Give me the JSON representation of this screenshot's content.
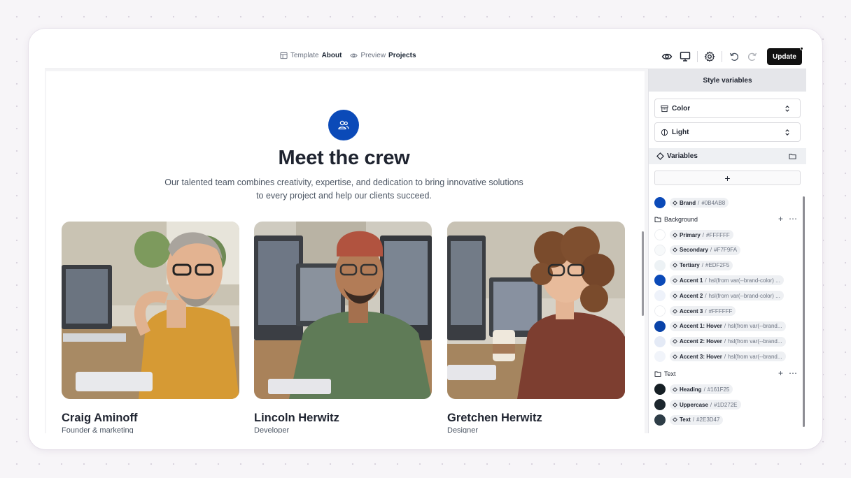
{
  "topbar": {
    "template_label": "Template",
    "template_value": "About",
    "preview_label": "Preview",
    "preview_value": "Projects",
    "update_label": "Update"
  },
  "page": {
    "title": "Meet the crew",
    "subtitle_line1": "Our talented team combines creativity, expertise, and dedication to bring innovative solutions",
    "subtitle_line2": "to every project and help our clients succeed.",
    "team": [
      {
        "name": "Craig Aminoff",
        "role": "Founder & marketing"
      },
      {
        "name": "Lincoln Herwitz",
        "role": "Developer"
      },
      {
        "name": "Gretchen Herwitz",
        "role": "Designer"
      }
    ]
  },
  "panel": {
    "title": "Style variables",
    "color_select": "Color",
    "mode_select": "Light",
    "variables_label": "Variables",
    "add_label": "+",
    "brand": {
      "name": "Brand",
      "value": "#0B4AB8",
      "color": "#0B4AB8"
    },
    "groups": [
      {
        "name": "Background",
        "items": [
          {
            "name": "Primary",
            "value": "#FFFFFF",
            "color": "#FFFFFF"
          },
          {
            "name": "Secondary",
            "value": "#F7F9FA",
            "color": "#F7F9FA"
          },
          {
            "name": "Tertiary",
            "value": "#EDF2F5",
            "color": "#EDF2F5"
          },
          {
            "name": "Accent 1",
            "value": "hsl(from var(--brand-color) ...",
            "color": "#0B4AB8"
          },
          {
            "name": "Accent 2",
            "value": "hsl(from var(--brand-color) ...",
            "color": "#EEF2FA"
          },
          {
            "name": "Accent 3",
            "value": "#FFFFFF",
            "color": "#FFFFFF"
          },
          {
            "name": "Accent 1: Hover",
            "value": "hsl(from var(--brand...",
            "color": "#0A43A8"
          },
          {
            "name": "Accent 2: Hover",
            "value": "hsl(from var(--brand...",
            "color": "#E4EAF6"
          },
          {
            "name": "Accent 3: Hover",
            "value": "hsl(from var(--brand...",
            "color": "#F1F4FA"
          }
        ]
      },
      {
        "name": "Text",
        "items": [
          {
            "name": "Heading",
            "value": "#161F25",
            "color": "#161F25"
          },
          {
            "name": "Uppercase",
            "value": "#1D272E",
            "color": "#1D272E"
          },
          {
            "name": "Text",
            "value": "#2E3D47",
            "color": "#2E3D47"
          }
        ]
      }
    ]
  },
  "colors": {
    "brand": "#0B4AB8",
    "heading": "#1F2430",
    "update_button": "#111111"
  },
  "icons": {
    "template": "layout-icon",
    "preview": "eye-icon",
    "toolbar": [
      "eye-icon",
      "monitor-icon",
      "gear-icon",
      "undo-icon",
      "redo-icon"
    ],
    "hero": "users-icon"
  }
}
